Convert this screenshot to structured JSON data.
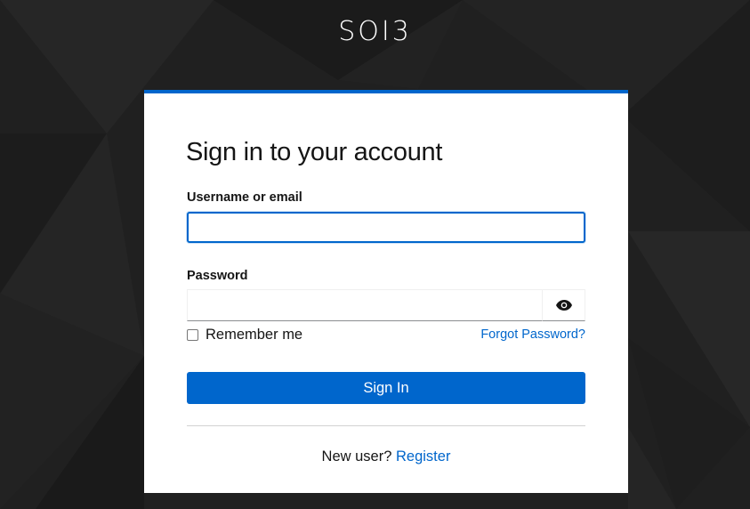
{
  "brand": {
    "name": "SOI3"
  },
  "login": {
    "title": "Sign in to your account",
    "username_label": "Username or email",
    "username_value": "",
    "password_label": "Password",
    "password_value": "",
    "show_password_icon": "eye-icon",
    "remember_label": "Remember me",
    "remember_checked": false,
    "forgot_label": "Forgot Password?",
    "submit_label": "Sign In",
    "new_user_text": "New user?",
    "register_label": "Register"
  },
  "colors": {
    "accent": "#0066cc",
    "background": "#1f1f1f",
    "card": "#ffffff",
    "text": "#151515"
  }
}
